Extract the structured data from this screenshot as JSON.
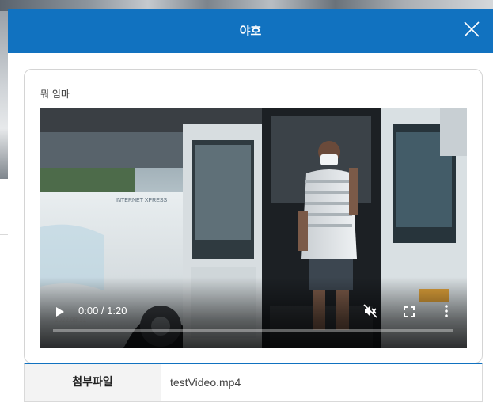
{
  "modal": {
    "title": "야호",
    "close_icon": "close-icon"
  },
  "post": {
    "body_text": "뭐 임마"
  },
  "video": {
    "time_display": "0:00 / 1:20",
    "progress_fraction": 0.0,
    "controls": [
      "play-icon",
      "mute-icon",
      "fullscreen-icon",
      "more-options-icon"
    ]
  },
  "attachment": {
    "header_label": "첨부파일",
    "file_name": "testVideo.mp4"
  },
  "colors": {
    "header_bg": "#1172c0",
    "accent_border": "#1172c0"
  }
}
